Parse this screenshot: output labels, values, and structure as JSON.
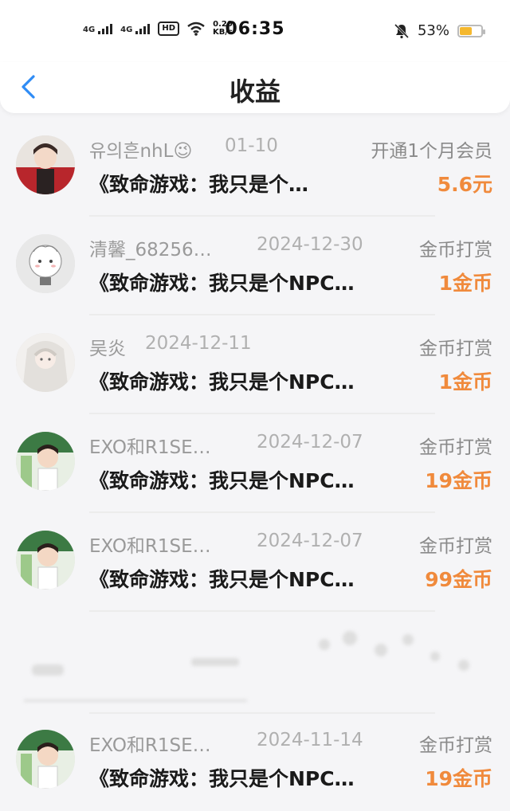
{
  "status_bar": {
    "network_1": "4G",
    "network_2": "4G",
    "hd": "HD",
    "speed_value": "0.20",
    "speed_unit": "KB/s",
    "time": "06:35",
    "battery": "53%"
  },
  "header": {
    "title": "收益"
  },
  "items": [
    {
      "name": "유의흔nhL😉",
      "date": "01-10",
      "type": "开通1个月会员",
      "book": "《致命游戏：我只是个…",
      "amount": "5.6元"
    },
    {
      "name": "清馨_68256…",
      "date": "2024-12-30",
      "type": "金币打赏",
      "book": "《致命游戏：我只是个NPC…",
      "amount": "1金币"
    },
    {
      "name": "吴炎",
      "date": "2024-12-11",
      "type": "金币打赏",
      "book": "《致命游戏：我只是个NPC…",
      "amount": "1金币"
    },
    {
      "name": "EXO和R1SE…",
      "date": "2024-12-07",
      "type": "金币打赏",
      "book": "《致命游戏：我只是个NPC…",
      "amount": "19金币"
    },
    {
      "name": "EXO和R1SE…",
      "date": "2024-12-07",
      "type": "金币打赏",
      "book": "《致命游戏：我只是个NPC…",
      "amount": "99金币"
    },
    {
      "name": "EXO和R1SE…",
      "date": "2024-11-14",
      "type": "金币打赏",
      "book": "《致命游戏：我只是个NPC…",
      "amount": "19金币"
    }
  ],
  "colors": {
    "accent": "#2f8cf5",
    "amount": "#f08a3c",
    "battery": "#f5b82e"
  }
}
